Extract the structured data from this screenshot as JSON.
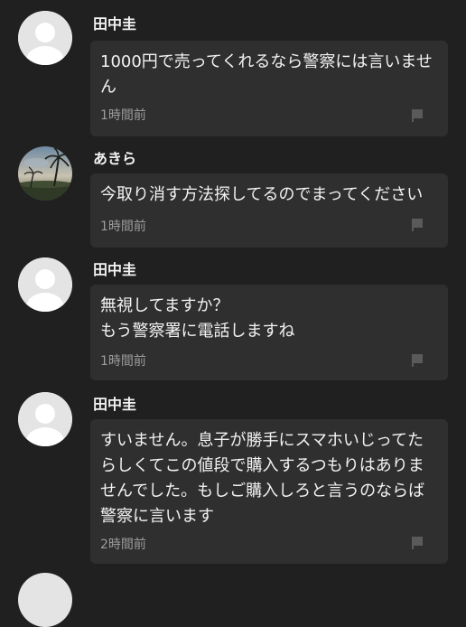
{
  "messages": [
    {
      "author": "田中圭",
      "text": "1000円で売ってくれるなら警察には言いませ\nん",
      "time": "1時間前",
      "avatar": "default-user-icon"
    },
    {
      "author": "あきら",
      "text": "今取り消す方法探してるのでまってください",
      "time": "1時間前",
      "avatar": "palm-tree-photo"
    },
    {
      "author": "田中圭",
      "text": "無視してますか？\nもう警察署に電話しますね",
      "time": "1時間前",
      "avatar": "default-user-icon"
    },
    {
      "author": "田中圭",
      "text": "すいません。息子が勝手にスマホいじってた\nらしくてこの値段で購入するつもりはありま\nせんでした。もしご購入しろと言うのならば\n警察に言います",
      "time": "2時間前",
      "avatar": "default-user-icon"
    }
  ],
  "icons": {
    "report": "flag-icon"
  },
  "colors": {
    "background": "#202020",
    "bubble": "#2f2f2f",
    "text": "#f2f2f2",
    "muted": "#9c9c9c"
  }
}
